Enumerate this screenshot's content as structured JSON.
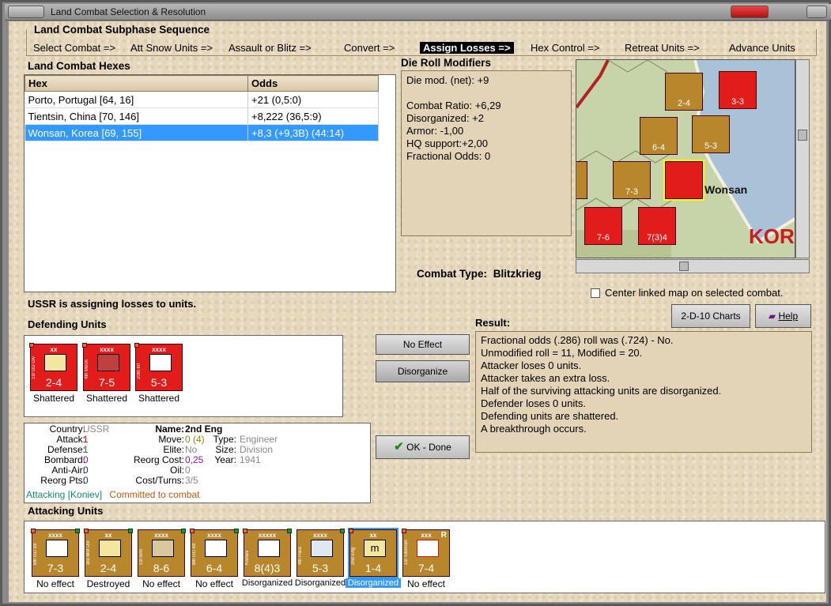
{
  "window": {
    "title": "Land Combat Selection & Resolution"
  },
  "subphase": {
    "title": "Land Combat Subphase Sequence",
    "steps": [
      "Select Combat =>",
      "Att Snow Units =>",
      "Assault or Blitz =>",
      "Convert =>",
      "Assign Losses =>",
      "Hex Control =>",
      "Retreat Units =>",
      "Advance Units"
    ],
    "active_index": 4
  },
  "hexes": {
    "title": "Land Combat Hexes",
    "headers": [
      "Hex",
      "Odds"
    ],
    "rows": [
      [
        "Porto, Portugal [64, 16]",
        "+21 (0,5:0)"
      ],
      [
        "Tientsin, China [70, 146]",
        "+8,222 (36,5:9)"
      ],
      [
        "Wonsan, Korea [69, 155]",
        "+8,3 (+9,3B) (44:14)"
      ]
    ],
    "selected_row": 2
  },
  "modifiers": {
    "title": "Die Roll Modifiers",
    "net": "Die mod. (net): +9",
    "lines": [
      "Combat Ratio: +6,29",
      "Disorganized: +2",
      "Armor: -1,00",
      "HQ support:+2,00",
      "Fractional Odds: 0"
    ]
  },
  "combat_type": {
    "label": "Combat Type:",
    "value": "Blitzkrieg"
  },
  "map": {
    "city": "Wonsan",
    "region": "KOR",
    "center_label": "Center linked map on selected combat."
  },
  "status": "USSR is assigning losses to units.",
  "defending": {
    "title": "Defending Units",
    "units": [
      {
        "size": "xx",
        "name": "1st GD Div",
        "str": "2-4",
        "status": "Shattered",
        "sym": "yellow"
      },
      {
        "size": "xxxx",
        "name": "4th Mech",
        "str": "7-5",
        "status": "Shattered",
        "sym": "armor"
      },
      {
        "size": "xxxx",
        "name": "20th Inf",
        "str": "5-3",
        "status": "Shattered",
        "sym": "inf"
      }
    ]
  },
  "buttons": {
    "no_effect": "No Effect",
    "disorganize": "Disorganize",
    "ok_done": "OK - Done",
    "charts": "2-D-10 Charts",
    "help": "Help"
  },
  "result": {
    "title": "Result:",
    "lines": [
      "Fractional odds (.286) roll was (.724)  - No.",
      "Unmodified roll = 11, Modified = 20.",
      "Attacker loses 0 units.",
      "Attacker takes an extra loss.",
      "Half of the surviving attacking units are disorganized.",
      "Defender loses 0 units.",
      "Defending units are shattered.",
      "A breakthrough occurs."
    ]
  },
  "unit_info": {
    "country_label": "Country:",
    "country": "USSR",
    "attack_label": "Attack:",
    "attack": "1",
    "defense_label": "Defense:",
    "defense": "1",
    "bombard_label": "Bombard:",
    "bombard": "0",
    "antiair_label": "Anti-Air:",
    "antiair": "0",
    "reorg_pts_label": "Reorg Pts:",
    "reorg_pts": "0",
    "name_label": "Name:",
    "name": "2nd Eng",
    "move_label": "Move:",
    "move": "0 (4)",
    "elite_label": "Elite:",
    "elite": "No",
    "reorg_cost_label": "Reorg Cost:",
    "reorg_cost": "0,25",
    "oil_label": "Oil:",
    "oil": "0",
    "cost_turns_label": "Cost/Turns:",
    "cost_turns": "3/5",
    "type_label": "Type:",
    "type": "Engineer",
    "size_label": "Size:",
    "size": "Division",
    "year_label": "Year:",
    "year": "1941",
    "attacking": "Attacking [Koniev]",
    "committed": "Committed to combat"
  },
  "attacking": {
    "title": "Attacking Units",
    "units": [
      {
        "size": "xxxx",
        "name": "6th GD Inf",
        "str": "7-3",
        "status": "No effect",
        "sym": "inf"
      },
      {
        "size": "xx",
        "name": "3rd Mot Div",
        "str": "2-4",
        "status": "Destroyed",
        "sym": "mot"
      },
      {
        "size": "xxxx",
        "name": "1st Arm",
        "str": "8-6",
        "status": "No effect",
        "sym": "armor"
      },
      {
        "size": "xxxx",
        "name": "8th GD Inf",
        "str": "6-4",
        "status": "No effect",
        "sym": "inf"
      },
      {
        "size": "xxxxx",
        "name": "Koniev",
        "str": "8(4)3",
        "status": "Disorganized",
        "sym": "hq"
      },
      {
        "size": "xxxx",
        "name": "4th Para",
        "str": "5-3",
        "status": "Disorganized",
        "sym": "para"
      },
      {
        "size": "xx",
        "name": "2nd Eng",
        "str": "1-4",
        "status": "Disorganized",
        "sym": "eng"
      },
      {
        "size": "xxx",
        "name": "1st Siberian",
        "str": "7-4",
        "status": "No effect",
        "sym": "red",
        "mark": "R"
      }
    ],
    "selected_index": 6
  },
  "colors": {
    "selection": "#3399ff",
    "soviet_red": "#e21b1b",
    "axis_gold": "#b8862b"
  }
}
